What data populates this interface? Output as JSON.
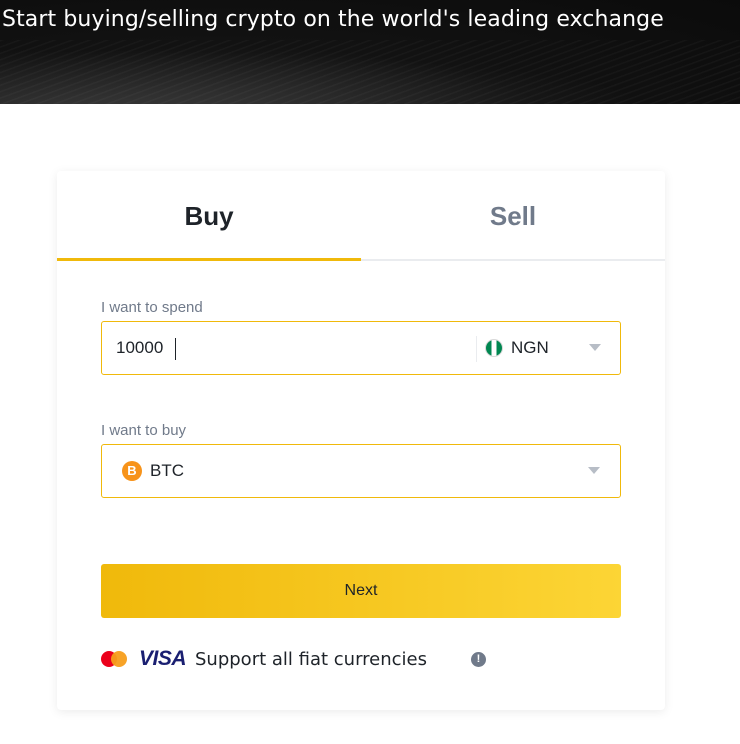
{
  "hero": {
    "title": "Start buying/selling crypto on the world's leading exchange"
  },
  "tabs": [
    {
      "label": "Buy",
      "active": true
    },
    {
      "label": "Sell",
      "active": false
    }
  ],
  "spend": {
    "label": "I want to spend",
    "amount": "10000",
    "currency": "NGN",
    "currency_icon": "nigeria-flag-icon"
  },
  "buy": {
    "label": "I want to buy",
    "asset": "BTC",
    "asset_icon_glyph": "B",
    "asset_icon": "bitcoin-icon"
  },
  "next_button": {
    "label": "Next"
  },
  "support": {
    "visa_text": "VISA",
    "text": "Support all fiat currencies",
    "info_glyph": "!"
  },
  "colors": {
    "accent": "#f0b90b",
    "accent_light": "#fcd535",
    "text_primary": "#1e2329",
    "text_secondary": "#707a8a"
  }
}
